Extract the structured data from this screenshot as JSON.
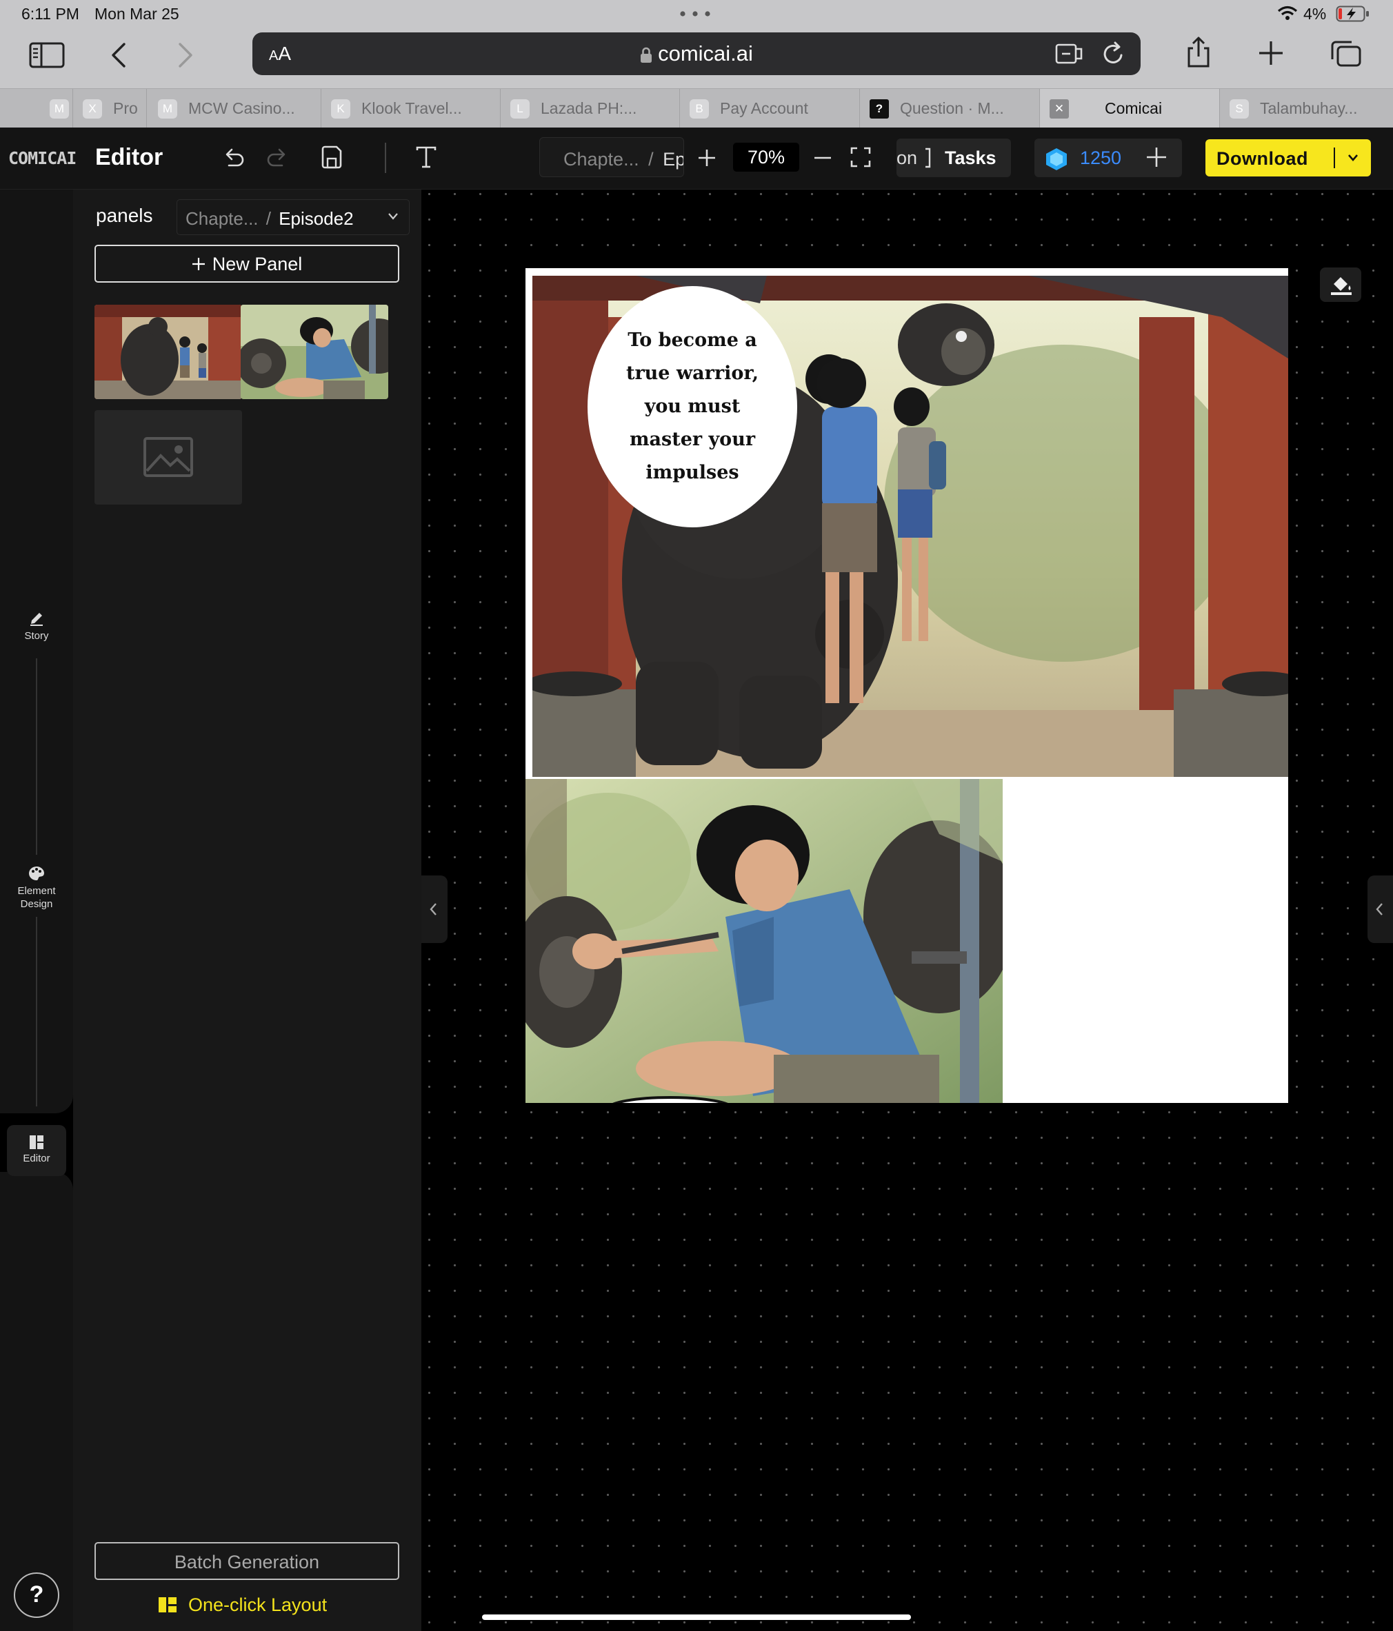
{
  "status_bar": {
    "time": "6:11 PM",
    "date": "Mon Mar 25",
    "battery": "4%"
  },
  "browser": {
    "text_size_label": "AA",
    "url": "comicai.ai",
    "tabs": [
      {
        "favicon": "M",
        "label": ""
      },
      {
        "favicon": "X",
        "label": "Pro"
      },
      {
        "favicon": "M",
        "label": "MCW Casino..."
      },
      {
        "favicon": "K",
        "label": "Klook Travel..."
      },
      {
        "favicon": "L",
        "label": "Lazada PH:..."
      },
      {
        "favicon": "B",
        "label": "Pay Account"
      },
      {
        "favicon": "?",
        "label": "Question · M..."
      },
      {
        "favicon": "✕",
        "label": "Comicai"
      },
      {
        "favicon": "S",
        "label": "Talambuhay..."
      }
    ],
    "active_tab": "Comicai"
  },
  "app": {
    "logo": "COMICAI",
    "title": "Editor",
    "breadcrumb_chapter": "Chapte...",
    "breadcrumb_separator": "/",
    "breadcrumb_episode_short": "Ep",
    "zoom": "70%",
    "tasks_prefix": "on",
    "tasks_label": "Tasks",
    "credits": "1250",
    "download_label": "Download",
    "accent_color": "#f7e61d",
    "credits_color": "#3b8cff"
  },
  "rail": {
    "story": "Story",
    "element_design_line1": "Element",
    "element_design_line2": "Design",
    "editor": "Editor",
    "help": "?"
  },
  "sidebar": {
    "title": "panels",
    "chapter": "Chapte...",
    "separator": "/",
    "episode": "Episode2",
    "new_panel": "New Panel",
    "batch_generation": "Batch Generation",
    "one_click_layout": "One-click Layout"
  },
  "canvas": {
    "speech_bubble": "To become a true warrior, you must master your impulses"
  }
}
